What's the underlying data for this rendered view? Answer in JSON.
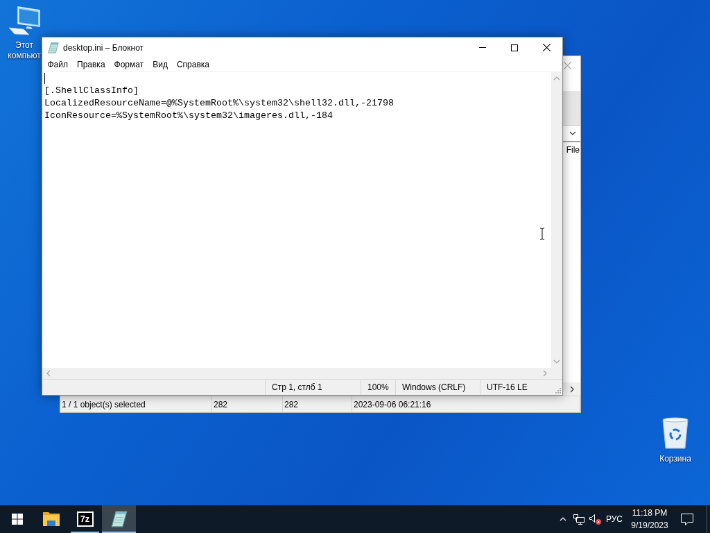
{
  "desktop_icons": [
    {
      "kind": "computer",
      "label": "Этот компьют"
    },
    {
      "kind": "recycle_bin",
      "label": "Корзина"
    }
  ],
  "background_window": {
    "column_header": "File",
    "status_bar": [
      "1 / 1 object(s) selected",
      "282",
      "282",
      "2023-09-06 06:21:16"
    ]
  },
  "notepad": {
    "title": "desktop.ini – Блокнот",
    "menu": [
      "Файл",
      "Правка",
      "Формат",
      "Вид",
      "Справка"
    ],
    "lines": [
      "[.ShellClassInfo]",
      "LocalizedResourceName=@%SystemRoot%\\system32\\shell32.dll,-21798",
      "IconResource=%SystemRoot%\\system32\\imageres.dll,-184"
    ],
    "status_bar": [
      "Стр 1, стлб 1",
      "100%",
      "Windows (CRLF)",
      "UTF-16 LE"
    ]
  },
  "taskbar": {
    "apps": [
      {
        "kind": "explorer",
        "running": false,
        "selected": false
      },
      {
        "kind": "archiver",
        "logo_text": "7z",
        "running": true,
        "selected": false
      },
      {
        "kind": "notepad",
        "running": true,
        "selected": true
      }
    ],
    "tray": {
      "volume_muted": true,
      "language": "РУС",
      "time": "11:18 PM",
      "date": "9/19/2023"
    }
  }
}
